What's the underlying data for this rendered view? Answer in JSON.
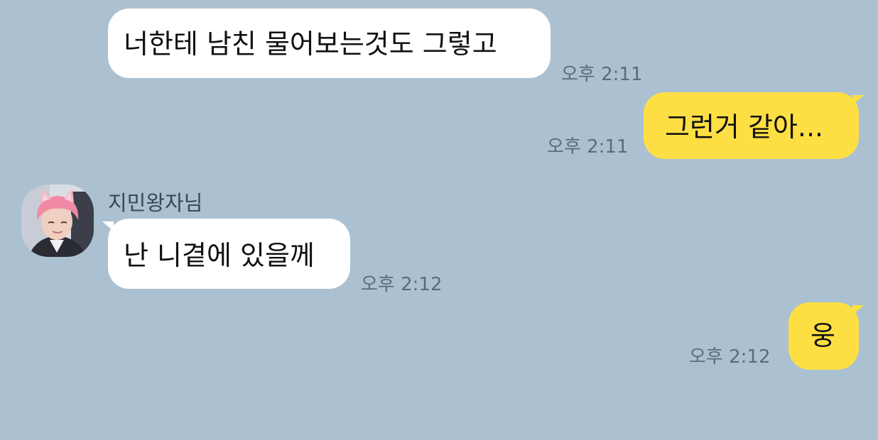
{
  "messages": [
    {
      "direction": "incoming",
      "text": "너한테 남친 물어보는것도 그렇고",
      "time": "오후 2:11"
    },
    {
      "direction": "outgoing",
      "text": "그런거 같아...",
      "time": "오후 2:11"
    },
    {
      "direction": "incoming",
      "sender": "지민왕자님",
      "avatar": "profile-photo-pink-hair",
      "text": "난 니곁에 있을께",
      "time": "오후 2:12"
    },
    {
      "direction": "outgoing",
      "text": "웅",
      "time": "오후 2:12"
    }
  ],
  "colors": {
    "background": "#abc1d1",
    "incoming_bubble": "#ffffff",
    "outgoing_bubble": "#fddf44",
    "timestamp": "#5d6b77"
  }
}
